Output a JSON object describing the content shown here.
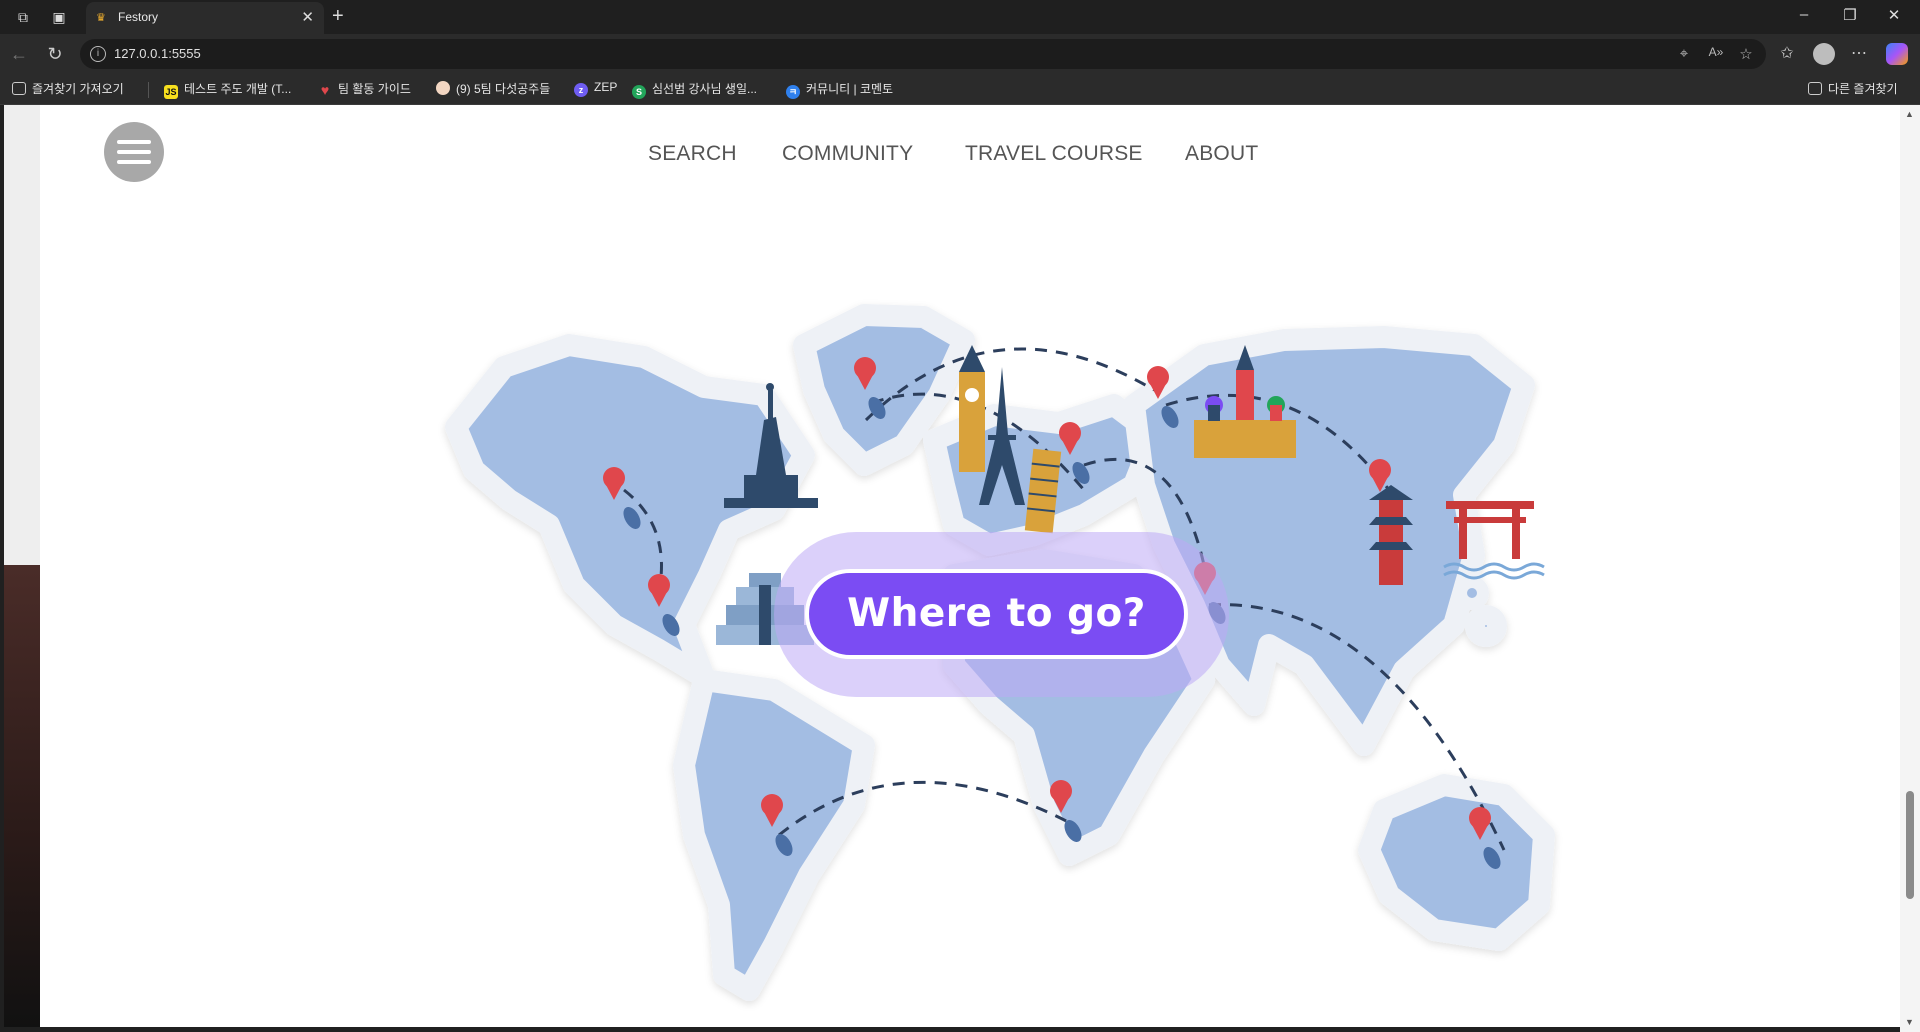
{
  "browser": {
    "tab_title": "Festory",
    "url": "127.0.0.1:5555",
    "bookmarks": [
      {
        "label": "즐겨찾기 가져오기",
        "icon": "folder-import-icon"
      },
      {
        "label": "테스트 주도 개발 (T...",
        "icon": "js-icon"
      },
      {
        "label": "팀 활동 가이드",
        "icon": "heart-icon"
      },
      {
        "label": "(9) 5팀 다섯공주들",
        "icon": "avatar-icon"
      },
      {
        "label": "ZEP",
        "icon": "zep-icon"
      },
      {
        "label": "심선범 강사님 생일...",
        "icon": "s-icon"
      },
      {
        "label": "커뮤니티 | 코멘토",
        "icon": "comento-icon"
      }
    ],
    "other_bookmarks": "다른 즐겨찾기"
  },
  "page": {
    "nav": [
      "SEARCH",
      "COMMUNITY",
      "TRAVEL COURSE",
      "ABOUT"
    ],
    "cta_label": "Where to go?"
  },
  "colors": {
    "map_land": "#a3bde3",
    "map_outline": "#e8ecf2",
    "pin": "#e0474c",
    "route": "#2c3e5c",
    "cta": "#7b4cf3"
  }
}
